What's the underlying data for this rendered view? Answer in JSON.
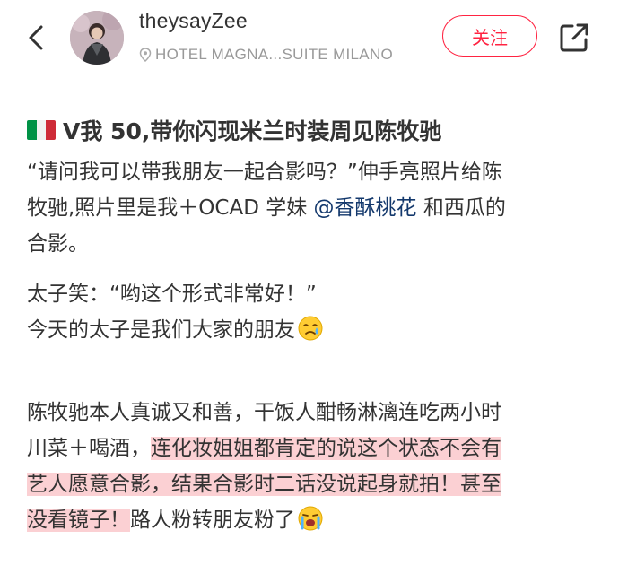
{
  "header": {
    "username": "theysayZee",
    "location": "HOTEL MAGNA...SUITE MILANO",
    "follow_label": "关注",
    "back_icon": "chevron-left-icon",
    "share_icon": "share-icon",
    "location_icon": "location-pin-icon"
  },
  "post": {
    "title_flag": "italy-flag",
    "title": "V我 50,带你闪现米兰时装周见陈牧驰",
    "lines": {
      "l1": "“请问我可以带我朋友一起合影吗？”伸手亮照片给陈",
      "l2_a": "牧驰,照片里是我＋OCAD 学妹 ",
      "l2_mention": "@香酥桃花",
      "l2_b": " 和西瓜的",
      "l3": "合影。",
      "l4": "太子笑：“哟这个形式非常好！”",
      "l5": "今天的太子是我们大家的朋友",
      "l7": "陈牧驰本人真诚又和善，干饭人酣畅淋漓连吃两小时",
      "l8_a": "川菜＋喝酒，",
      "l8_hl": "连化妆姐姐都肯定的说这个状态不会有",
      "l9_hl": "艺人愿意合影，结果合影时二话没说起身就拍！甚至",
      "l10_hl": "没看镜子！",
      "l10_b": "路人粉转朋友粉了"
    },
    "emojis": [
      "crying-face-emoji",
      "loudly-crying-face-emoji"
    ],
    "highlight_color": "#fbd0d3",
    "mention_color": "#13386c",
    "accent_color": "#ff2442"
  }
}
